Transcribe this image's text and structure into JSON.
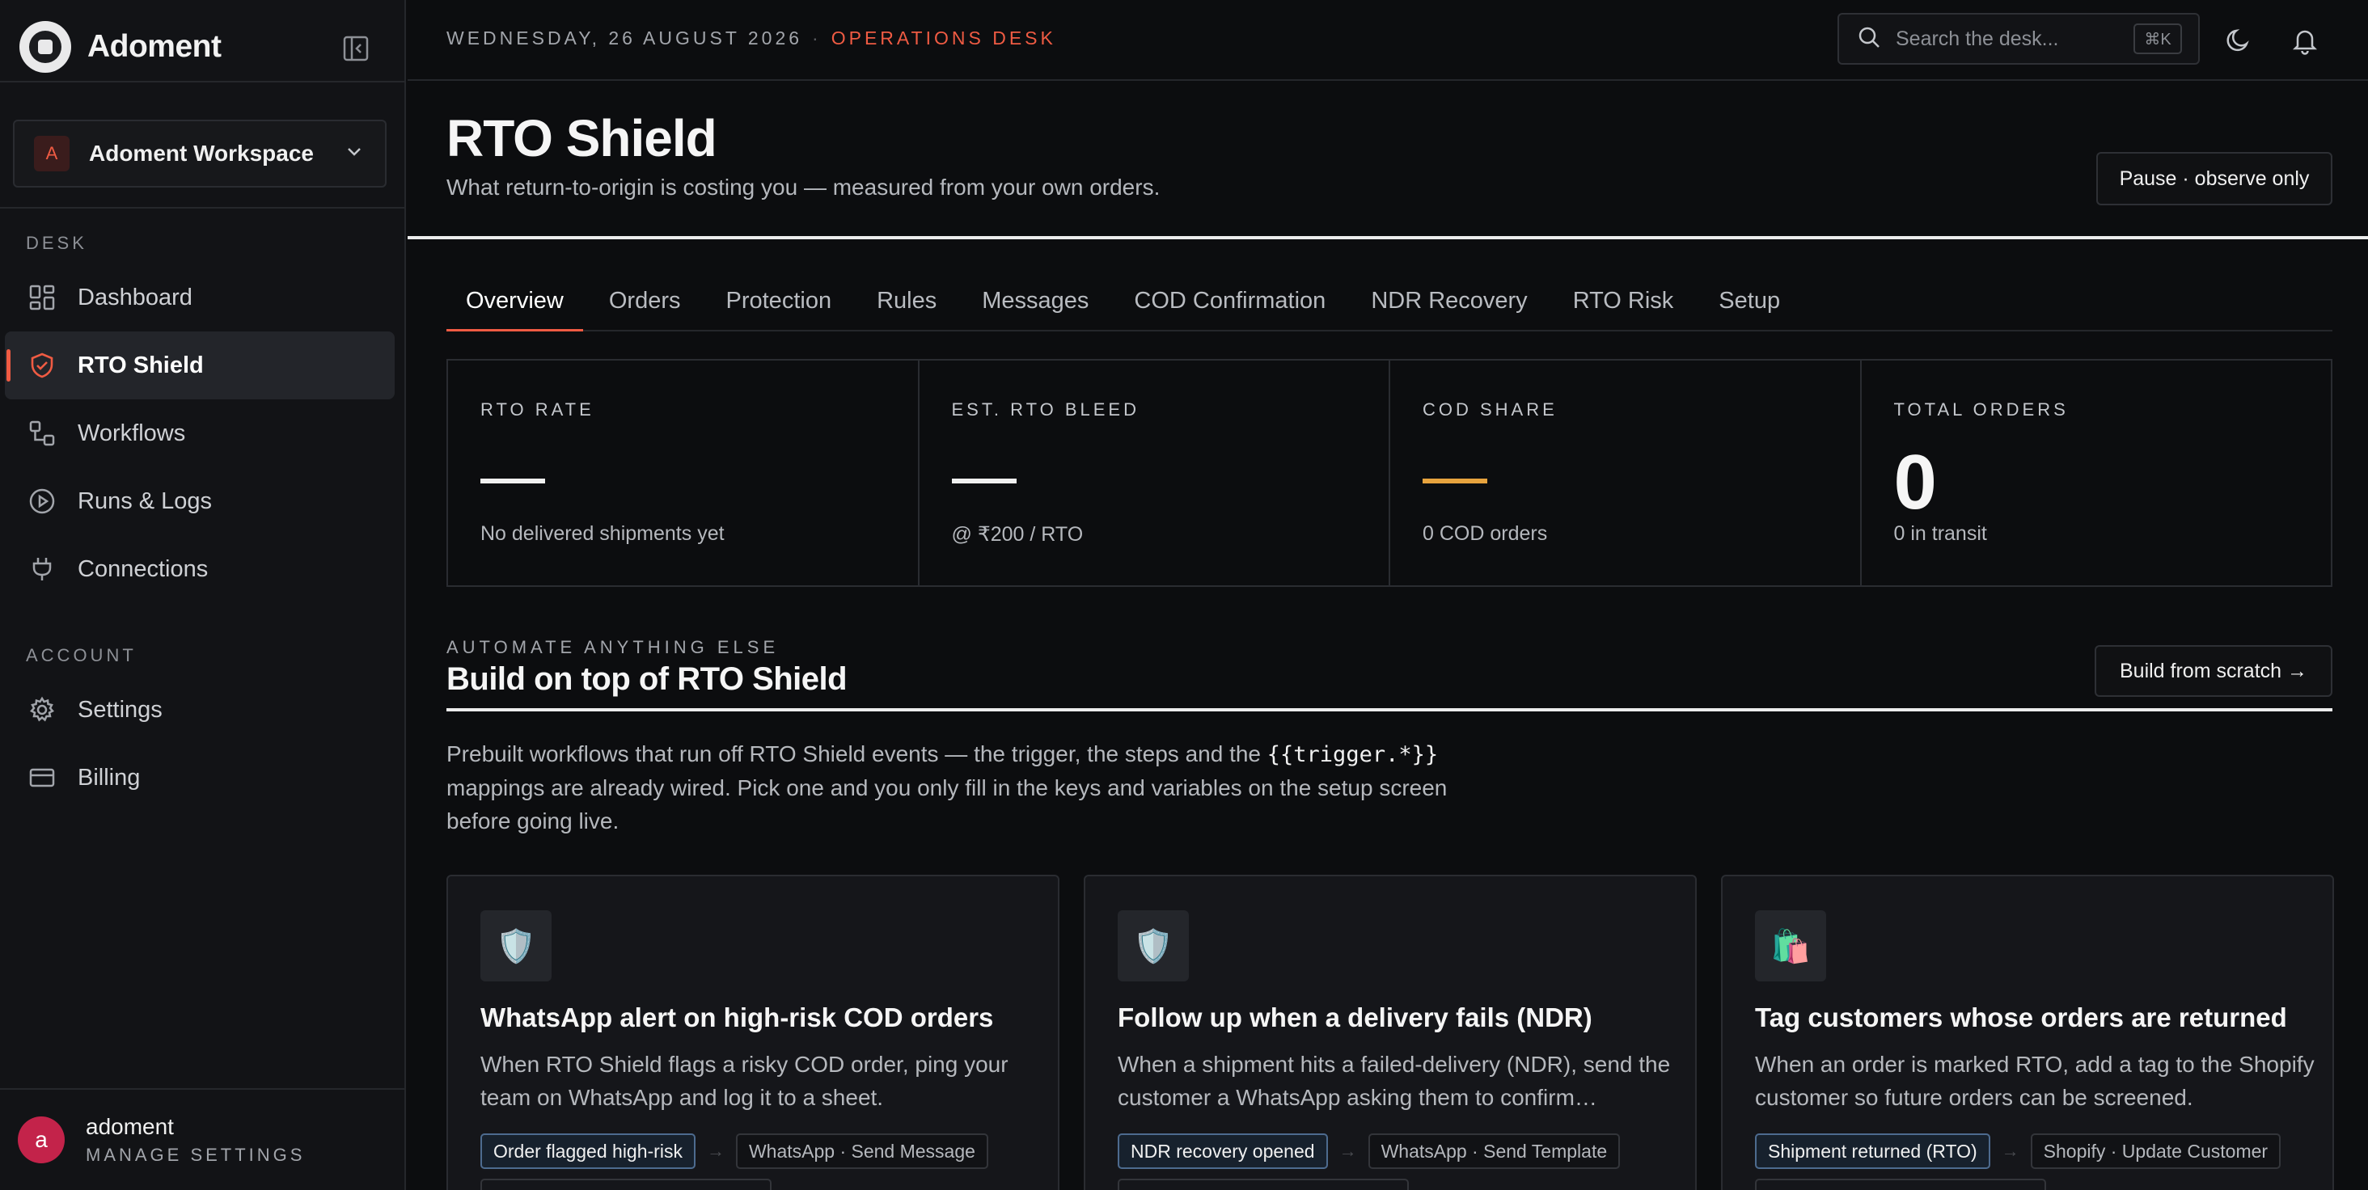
{
  "app": {
    "name": "Adoment"
  },
  "workspace": {
    "avatar": "A",
    "name": "Adoment Workspace"
  },
  "sidebar": {
    "desk_label": "DESK",
    "desk_items": [
      {
        "label": "Dashboard",
        "icon": "dashboard-icon",
        "active": false
      },
      {
        "label": "RTO Shield",
        "icon": "shield-icon",
        "active": true
      },
      {
        "label": "Workflows",
        "icon": "workflow-icon",
        "active": false
      },
      {
        "label": "Runs & Logs",
        "icon": "play-circle-icon",
        "active": false
      },
      {
        "label": "Connections",
        "icon": "plug-icon",
        "active": false
      }
    ],
    "account_label": "ACCOUNT",
    "account_items": [
      {
        "label": "Settings",
        "icon": "gear-icon",
        "active": false
      },
      {
        "label": "Billing",
        "icon": "credit-card-icon",
        "active": false
      }
    ]
  },
  "user": {
    "avatar": "a",
    "name": "adoment",
    "sub": "MANAGE SETTINGS"
  },
  "topbar": {
    "date": "WEDNESDAY, 26 AUGUST 2026",
    "separator": "·",
    "context": "OPERATIONS DESK",
    "search_placeholder": "Search the desk...",
    "search_shortcut": "⌘K"
  },
  "page": {
    "title": "RTO Shield",
    "subtitle": "What return-to-origin is costing you — measured from your own orders.",
    "pause_button": "Pause · observe only"
  },
  "tabs": [
    "Overview",
    "Orders",
    "Protection",
    "Rules",
    "Messages",
    "COD Confirmation",
    "NDR Recovery",
    "RTO Risk",
    "Setup"
  ],
  "active_tab": "Overview",
  "stats": {
    "rto_rate": {
      "label": "RTO RATE",
      "note": "No delivered shipments yet"
    },
    "rto_bleed": {
      "label": "EST. RTO BLEED",
      "note": "@ ₹200 / RTO"
    },
    "cod_share": {
      "label": "COD SHARE",
      "note": "0 COD orders"
    },
    "total_orders": {
      "label": "TOTAL ORDERS",
      "value": "0",
      "note": "0 in transit"
    }
  },
  "automate": {
    "eyebrow": "AUTOMATE ANYTHING ELSE",
    "title": "Build on top of RTO Shield",
    "button": "Build from scratch →",
    "intro_before": "Prebuilt workflows that run off RTO Shield events — the trigger, the steps and the ",
    "intro_code": "{{trigger.*}}",
    "intro_after": " mappings are already wired. Pick one and you only fill in the keys and variables on the setup screen before going live."
  },
  "cards": [
    {
      "icon": "🛡️",
      "title": "WhatsApp alert on high-risk COD orders",
      "desc": "When RTO Shield flags a risky COD order, ping your team on WhatsApp and log it to a sheet.",
      "trigger": "Order flagged high-risk",
      "step": "WhatsApp · Send Message"
    },
    {
      "icon": "🛡️",
      "title": "Follow up when a delivery fails (NDR)",
      "desc": "When a shipment hits a failed-delivery (NDR), send the customer a WhatsApp asking them to confirm…",
      "trigger": "NDR recovery opened",
      "step": "WhatsApp · Send Template"
    },
    {
      "icon": "🛍️",
      "title": "Tag customers whose orders are returned",
      "desc": "When an order is marked RTO, add a tag to the Shopify customer so future orders can be screened.",
      "trigger": "Shipment returned (RTO)",
      "step": "Shopify · Update Customer"
    }
  ],
  "colors": {
    "accent": "#ef5b43",
    "amber": "#e7a33e",
    "background": "#0c0d0f"
  }
}
